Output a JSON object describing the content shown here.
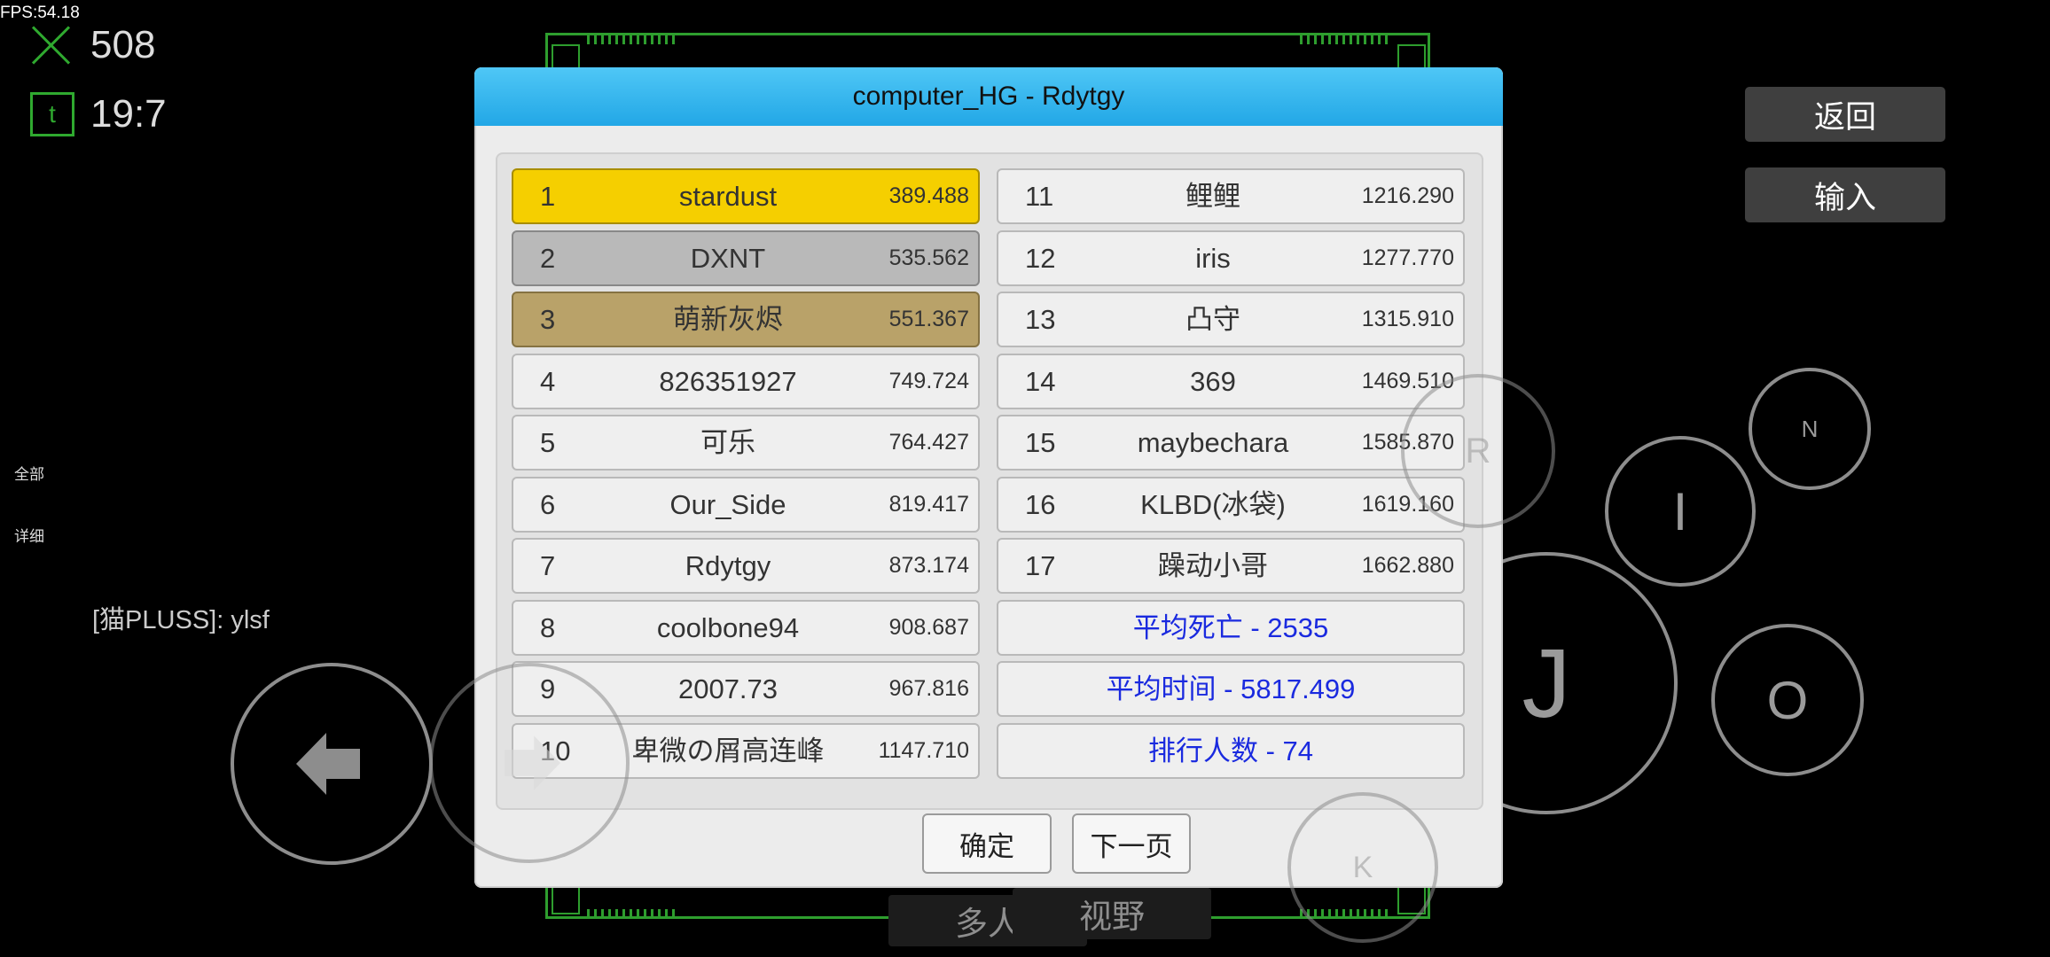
{
  "hud": {
    "fps": "FPS:54.18",
    "deaths": "508",
    "time": "19:7",
    "time_icon": "t",
    "side_label_all": "全部",
    "side_label_detail": "详细",
    "chat_line": "[猫PLUSS]: ylsf"
  },
  "menu": {
    "back": "返回",
    "input": "输入"
  },
  "controls": {
    "n": "N",
    "i": "I",
    "j": "J",
    "o": "O",
    "r": "R",
    "k": "K"
  },
  "bottom_tabs": {
    "multi": "多人",
    "view": "视野"
  },
  "dialog": {
    "title": "computer_HG - Rdytgy",
    "ok": "确定",
    "next_page": "下一页"
  },
  "leaderboard": {
    "left": [
      {
        "rank": "1",
        "name": "stardust",
        "time": "389.488"
      },
      {
        "rank": "2",
        "name": "DXNT",
        "time": "535.562"
      },
      {
        "rank": "3",
        "name": "萌新灰烬",
        "time": "551.367"
      },
      {
        "rank": "4",
        "name": "826351927",
        "time": "749.724"
      },
      {
        "rank": "5",
        "name": "可乐",
        "time": "764.427"
      },
      {
        "rank": "6",
        "name": "Our_Side",
        "time": "819.417"
      },
      {
        "rank": "7",
        "name": "Rdytgy",
        "time": "873.174"
      },
      {
        "rank": "8",
        "name": "coolbone94",
        "time": "908.687"
      },
      {
        "rank": "9",
        "name": "2007.73",
        "time": "967.816"
      },
      {
        "rank": "10",
        "name": "卑微の屑高连峰",
        "time": "1147.710"
      }
    ],
    "right": [
      {
        "rank": "11",
        "name": "鲤鲤",
        "time": "1216.290"
      },
      {
        "rank": "12",
        "name": "iris",
        "time": "1277.770"
      },
      {
        "rank": "13",
        "name": "凸守",
        "time": "1315.910"
      },
      {
        "rank": "14",
        "name": "369",
        "time": "1469.510"
      },
      {
        "rank": "15",
        "name": "maybechara",
        "time": "1585.870"
      },
      {
        "rank": "16",
        "name": "KLBD(冰袋)",
        "time": "1619.160"
      },
      {
        "rank": "17",
        "name": "躁动小哥",
        "time": "1662.880"
      }
    ],
    "stats": {
      "avg_deaths": "平均死亡 - 2535",
      "avg_time": "平均时间 - 5817.499",
      "player_count": "排行人数 - 74"
    }
  },
  "colors": {
    "gold": "#f5cf00",
    "silver": "#b9b9b9",
    "bronze": "#b9a269",
    "stat_text": "#1a2adf",
    "title_bar": "#22a7e6",
    "frame": "#2e9e2e"
  }
}
